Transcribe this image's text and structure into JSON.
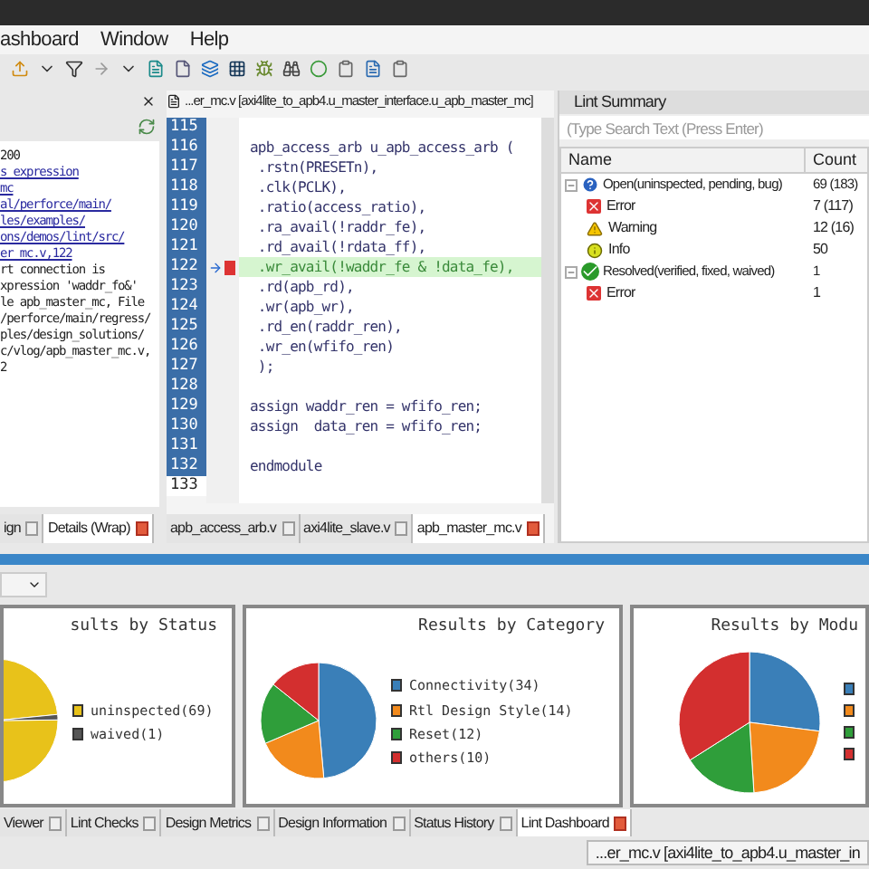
{
  "menu": [
    "ashboard",
    "Window",
    "Help"
  ],
  "left_panel": {
    "lines": [
      {
        "text": "200",
        "link": false
      },
      {
        "text": "s_expression",
        "link": true
      },
      {
        "text": "mc",
        "link": true
      },
      {
        "text": "al/perforce/main/",
        "link": true
      },
      {
        "text": "les/examples/",
        "link": true
      },
      {
        "text": "ons/demos/lint/src/",
        "link": true
      },
      {
        "text": "er_mc.v,122",
        "link": true
      },
      {
        "text": "rt connection is",
        "link": false
      },
      {
        "text": "xpression 'waddr_fo&'",
        "link": false
      },
      {
        "text": "le apb_master_mc, File",
        "link": false
      },
      {
        "text": "/perforce/main/regress/",
        "link": false
      },
      {
        "text": "ples/design_solutions/",
        "link": false
      },
      {
        "text": "c/vlog/apb_master_mc.v,",
        "link": false
      },
      {
        "text": "2",
        "link": false
      }
    ],
    "tabs": [
      {
        "label": "ign",
        "selected": false
      },
      {
        "label": "Details (Wrap)",
        "selected": true
      }
    ]
  },
  "editor": {
    "title": "...er_mc.v [axi4lite_to_apb4.u_master_interface.u_apb_master_mc]",
    "lines": [
      {
        "number": "115",
        "highlighted": false,
        "error": false
      },
      {
        "number": "116",
        "code": "apb_access_arb u_apb_access_arb (",
        "highlighted": false,
        "error": false
      },
      {
        "number": "117",
        "code": " .rstn(PRESETn),",
        "highlighted": false,
        "error": false
      },
      {
        "number": "118",
        "code": " .clk(PCLK),",
        "highlighted": false,
        "error": false
      },
      {
        "number": "119",
        "code": " .ratio(access_ratio),",
        "highlighted": false,
        "error": false
      },
      {
        "number": "120",
        "code": " .ra_avail(!raddr_fe),",
        "highlighted": false,
        "error": false
      },
      {
        "number": "121",
        "code": " .rd_avail(!rdata_ff),",
        "highlighted": false,
        "error": false
      },
      {
        "number": "122",
        "code": " .wr_avail(!waddr_fe & !data_fe),",
        "highlighted": true,
        "error": true
      },
      {
        "number": "123",
        "code": " .rd(apb_rd),",
        "highlighted": false,
        "error": false
      },
      {
        "number": "124",
        "code": " .wr(apb_wr),",
        "highlighted": false,
        "error": false
      },
      {
        "number": "125",
        "code": " .rd_en(raddr_ren),",
        "highlighted": false,
        "error": false
      },
      {
        "number": "126",
        "code": " .wr_en(wfifo_ren)",
        "highlighted": false,
        "error": false
      },
      {
        "number": "127",
        "code": " );",
        "highlighted": false,
        "error": false
      },
      {
        "number": "128",
        "highlighted": false,
        "error": false
      },
      {
        "number": "129",
        "code": "assign waddr_ren = wfifo_ren;",
        "highlighted": false,
        "error": false
      },
      {
        "number": "130",
        "code": "assign  data_ren = wfifo_ren;",
        "highlighted": false,
        "error": false
      },
      {
        "number": "131",
        "highlighted": false,
        "error": false
      },
      {
        "number": "132",
        "code": "endmodule",
        "highlighted": false,
        "error": false
      },
      {
        "number": "133",
        "highlighted": false,
        "error": false
      }
    ],
    "tabs": [
      {
        "label": "apb_access_arb.v",
        "selected": false
      },
      {
        "label": "axi4lite_slave.v",
        "selected": false
      },
      {
        "label": "apb_master_mc.v",
        "selected": true
      }
    ]
  },
  "lint_summary": {
    "title": "Lint Summary",
    "search": {
      "placeholder": "(Type Search Text (Press Enter)"
    },
    "columns": [
      "Name",
      "Count"
    ],
    "rows": [
      {
        "kind": "open",
        "name": "Open(uninspected, pending, bug)",
        "count": "69 (183)",
        "expanded": true,
        "children": [
          {
            "kind": "error",
            "name": "Error",
            "count": "7 (117)"
          },
          {
            "kind": "warning",
            "name": "Warning",
            "count": "12 (16)"
          },
          {
            "kind": "info",
            "name": "Info",
            "count": "50"
          }
        ]
      },
      {
        "kind": "resolved",
        "name": "Resolved(verified, fixed, waived)",
        "count": "1",
        "expanded": true,
        "children": [
          {
            "kind": "error",
            "name": "Error",
            "count": "1"
          }
        ]
      }
    ]
  },
  "dashboard": {
    "charts": [
      {
        "chart_data": {
          "type": "pie",
          "title": "sults by Status",
          "categories": [
            "uninspected(69)",
            "waived(1)"
          ],
          "values": [
            69,
            1
          ],
          "colors": [
            "#e8c21a",
            "#555555"
          ]
        }
      },
      {
        "chart_data": {
          "type": "pie",
          "title": "Results by Category",
          "categories": [
            "Connectivity(34)",
            "Rtl Design Style(14)",
            "Reset(12)",
            "others(10)"
          ],
          "values": [
            34,
            14,
            12,
            10
          ],
          "colors": [
            "#3a7fb8",
            "#f28a1c",
            "#2f9e3a",
            "#d32f2f"
          ]
        }
      }
    ],
    "module_chart_title": "Results by Modu"
  },
  "bottom_tabs": [
    {
      "label": "Viewer",
      "selected": false
    },
    {
      "label": "Lint Checks",
      "selected": false
    },
    {
      "label": "Design Metrics",
      "selected": false
    },
    {
      "label": "Design Information",
      "selected": false
    },
    {
      "label": "Status History",
      "selected": false
    },
    {
      "label": "Lint Dashboard",
      "selected": true
    }
  ],
  "status_bar": "...er_mc.v [axi4lite_to_apb4.u_master_in"
}
